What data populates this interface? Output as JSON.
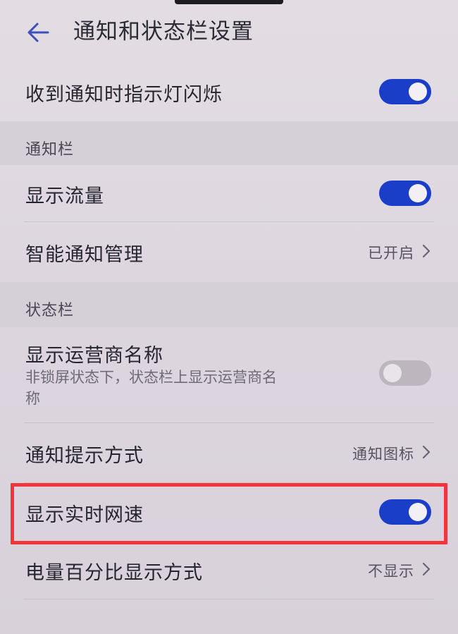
{
  "header": {
    "title": "通知和状态栏设置"
  },
  "rows": {
    "notify_light": {
      "label": "收到通知时指示灯闪烁",
      "state": "on"
    },
    "section_notification": {
      "label": "通知栏"
    },
    "show_traffic": {
      "label": "显示流量",
      "state": "on"
    },
    "smart_notify": {
      "label": "智能通知管理",
      "value": "已开启"
    },
    "section_statusbar": {
      "label": "状态栏"
    },
    "carrier_name": {
      "label": "显示运营商名称",
      "sub_line1": "非锁屏状态下，状态栏上显示运营商名",
      "sub_line2": "称",
      "state": "off"
    },
    "notify_style": {
      "label": "通知提示方式",
      "value": "通知图标"
    },
    "net_speed": {
      "label": "显示实时网速",
      "state": "on"
    },
    "battery_percent": {
      "label": "电量百分比显示方式",
      "value": "不显示"
    }
  },
  "colors": {
    "toggle_on": "#1a3ec7",
    "toggle_off": "#bdb6bf",
    "highlight": "#f0353b",
    "accent_back": "#3d4fb8"
  },
  "icons": {
    "back": "back-arrow-icon",
    "chevron": "chevron-right-icon"
  }
}
